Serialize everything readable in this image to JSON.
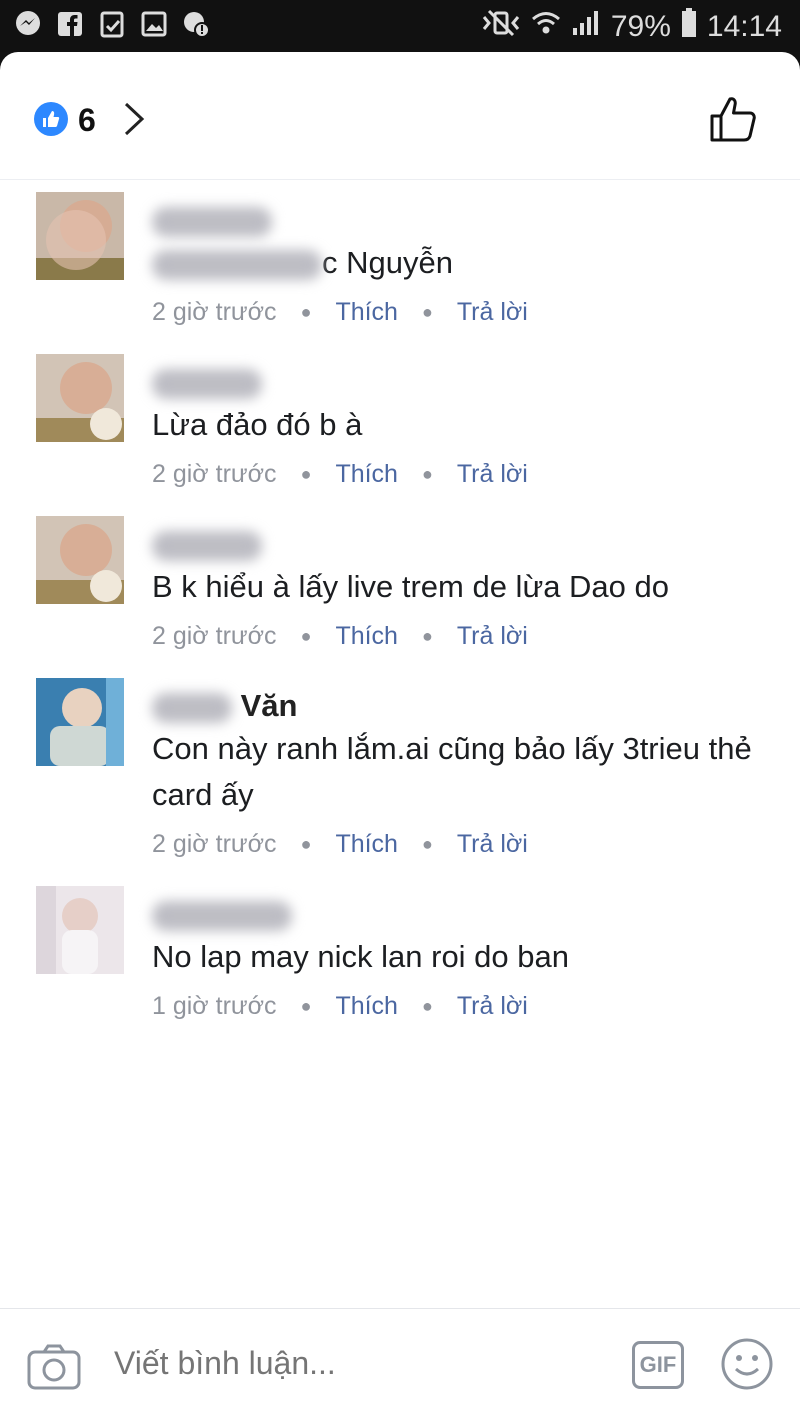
{
  "status_bar": {
    "battery": "79%",
    "time": "14:14"
  },
  "reactions": {
    "count": "6"
  },
  "comments": [
    {
      "name_visible": "c Nguyễn",
      "text": "",
      "time": "2 giờ trước",
      "like": "Thích",
      "reply": "Trả lời"
    },
    {
      "name_visible": "",
      "text": "Lừa đảo đó b à",
      "time": "2 giờ trước",
      "like": "Thích",
      "reply": "Trả lời"
    },
    {
      "name_visible": "",
      "text": "B k hiểu à lấy live trem de lừa Dao do",
      "time": "2 giờ trước",
      "like": "Thích",
      "reply": "Trả lời"
    },
    {
      "name_visible": "Văn",
      "text": "Con này ranh lắm.ai cũng bảo lấy 3trieu thẻ card ấy",
      "time": "2 giờ trước",
      "like": "Thích",
      "reply": "Trả lời"
    },
    {
      "name_visible": "",
      "text": "No lap may nick lan roi do ban",
      "time": "1 giờ trước",
      "like": "Thích",
      "reply": "Trả lời"
    }
  ],
  "composer": {
    "placeholder": "Viết bình luận...",
    "gif_label": "GIF"
  },
  "icons": {
    "status_left": [
      "messenger-icon",
      "facebook-icon",
      "clipboard-icon",
      "gallery-icon",
      "location-alert-icon"
    ],
    "status_right": [
      "vibrate-mute-icon",
      "wifi-icon",
      "signal-icon",
      "battery-icon"
    ],
    "header": [
      "like-badge-icon",
      "chevron-right-icon",
      "like-outline-icon"
    ],
    "footer": [
      "camera-icon",
      "gif-icon",
      "emoji-icon"
    ]
  },
  "colors": {
    "accent": "#2d88ff",
    "action_link": "#4b67a1",
    "meta_gray": "#90949c"
  }
}
